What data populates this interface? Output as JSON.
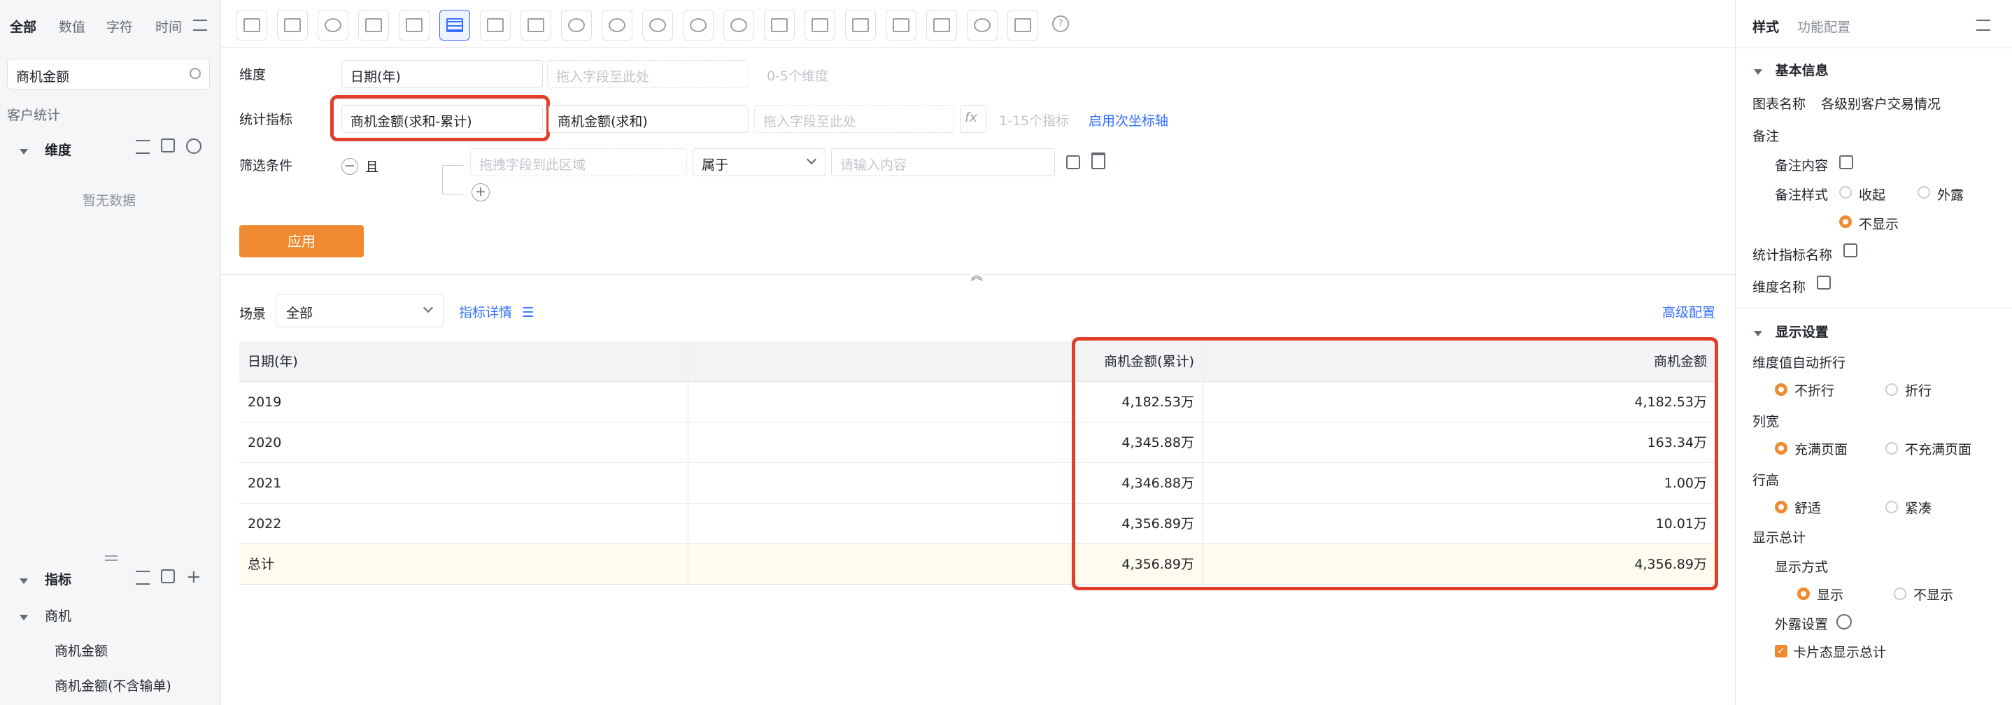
{
  "left": {
    "tabs": [
      "全部",
      "数值",
      "字符",
      "时间"
    ],
    "search_value": "商机金额",
    "dataset": "客户统计",
    "dimension_header": "维度",
    "empty_text": "暂无数据",
    "metric_header": "指标",
    "group": "商机",
    "items": [
      "商机金额",
      "商机金额(不含输单)"
    ]
  },
  "config": {
    "dimension_label": "维度",
    "dimension_field": "日期(年)",
    "dimension_drop": "拖入字段至此处",
    "dimension_hint": "0-5个维度",
    "metric_label": "统计指标",
    "metric_field_1": "商机金额(求和-累计)",
    "metric_field_2": "商机金额(求和)",
    "metric_drop": "拖入字段至此处",
    "fx": "fx",
    "metric_hint": "1-15个指标",
    "secondary_axis": "启用次坐标轴",
    "filter_label": "筛选条件",
    "filter_and": "且",
    "filter_drop": "拖拽字段到此区域",
    "filter_op": "属于",
    "filter_input_placeholder": "请输入内容",
    "apply": "应用"
  },
  "scene": {
    "label": "场景",
    "value": "全部",
    "metric_detail": "指标详情",
    "advanced": "高级配置"
  },
  "table": {
    "headers": [
      "日期(年)",
      "",
      "商机金额(累计)",
      "商机金额"
    ],
    "rows": [
      [
        "2019",
        "",
        "4,182.53万",
        "4,182.53万"
      ],
      [
        "2020",
        "",
        "4,345.88万",
        "163.34万"
      ],
      [
        "2021",
        "",
        "4,346.88万",
        "1.00万"
      ],
      [
        "2022",
        "",
        "4,356.89万",
        "10.01万"
      ]
    ],
    "total": [
      "总计",
      "",
      "4,356.89万",
      "4,356.89万"
    ]
  },
  "right": {
    "tab_style": "样式",
    "tab_function": "功能配置",
    "basic_info": "基本信息",
    "chart_name_label": "图表名称",
    "chart_name_value": "各级别客户交易情况",
    "remark": "备注",
    "remark_content": "备注内容",
    "remark_style": "备注样式",
    "remark_opts": [
      "收起",
      "外露",
      "不显示"
    ],
    "metric_name": "统计指标名称",
    "dimension_name": "维度名称",
    "display_settings": "显示设置",
    "wrap_label": "维度值自动折行",
    "wrap_opts": [
      "不折行",
      "折行"
    ],
    "colwidth_label": "列宽",
    "colwidth_opts": [
      "充满页面",
      "不充满页面"
    ],
    "rowheight_label": "行高",
    "rowheight_opts": [
      "舒适",
      "紧凑"
    ],
    "total_label": "显示总计",
    "display_mode": "显示方式",
    "display_opts": [
      "显示",
      "不显示"
    ],
    "expose_settings": "外露设置",
    "card_total": "卡片态显示总计"
  },
  "colors": {
    "accent": "#f08a30",
    "highlight": "#e0402a",
    "link": "#3370ff"
  }
}
